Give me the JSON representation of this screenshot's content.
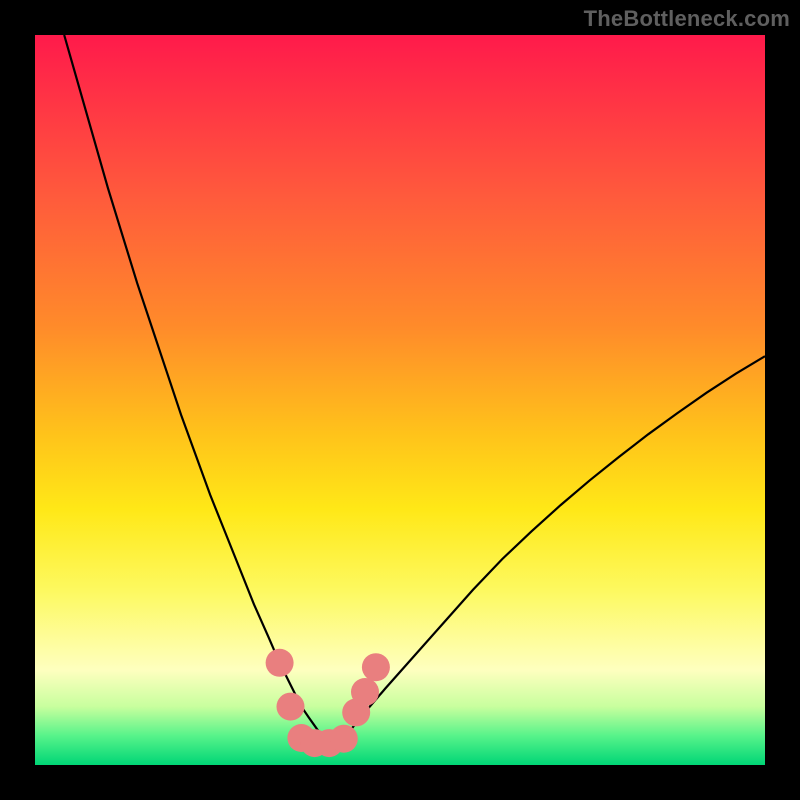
{
  "watermark": "TheBottleneck.com",
  "chart_data": {
    "type": "line",
    "title": "",
    "xlabel": "",
    "ylabel": "",
    "xlim": [
      0,
      100
    ],
    "ylim": [
      0,
      100
    ],
    "grid": false,
    "series": [
      {
        "name": "curve",
        "color": "#000000",
        "x": [
          4,
          6,
          8,
          10,
          12,
          14,
          16,
          18,
          20,
          22,
          24,
          26,
          28,
          30,
          32,
          33.5,
          35,
          36.5,
          37.5,
          40,
          42,
          43,
          45,
          48,
          52,
          56,
          60,
          64,
          68,
          72,
          76,
          80,
          84,
          88,
          92,
          96,
          100
        ],
        "y": [
          100,
          93,
          86,
          79,
          72.5,
          66,
          60,
          54,
          48,
          42.5,
          37,
          32,
          27,
          22,
          17.5,
          14,
          11,
          8,
          6.5,
          3,
          3,
          4.5,
          7,
          10.5,
          15,
          19.5,
          24,
          28.2,
          32,
          35.6,
          39,
          42.2,
          45.3,
          48.2,
          51,
          53.6,
          56
        ]
      }
    ],
    "markers": {
      "color": "#e97f7f",
      "points": [
        {
          "x": 33.5,
          "y": 14
        },
        {
          "x": 35,
          "y": 8
        },
        {
          "x": 36.5,
          "y": 3.7
        },
        {
          "x": 38.3,
          "y": 3
        },
        {
          "x": 40.3,
          "y": 3
        },
        {
          "x": 42.3,
          "y": 3.6
        },
        {
          "x": 44,
          "y": 7.2
        },
        {
          "x": 45.2,
          "y": 10
        },
        {
          "x": 46.7,
          "y": 13.4
        }
      ],
      "radius": 14
    },
    "gradient_stops": [
      {
        "pos": 0,
        "color": "#ff1a4b"
      },
      {
        "pos": 22,
        "color": "#ff5a3c"
      },
      {
        "pos": 40,
        "color": "#ff8b2a"
      },
      {
        "pos": 55,
        "color": "#ffc41a"
      },
      {
        "pos": 65,
        "color": "#ffe817"
      },
      {
        "pos": 76,
        "color": "#fdf95f"
      },
      {
        "pos": 87,
        "color": "#feffbf"
      },
      {
        "pos": 92,
        "color": "#c8ff9e"
      },
      {
        "pos": 96,
        "color": "#57f38a"
      },
      {
        "pos": 100,
        "color": "#00d676"
      }
    ]
  }
}
